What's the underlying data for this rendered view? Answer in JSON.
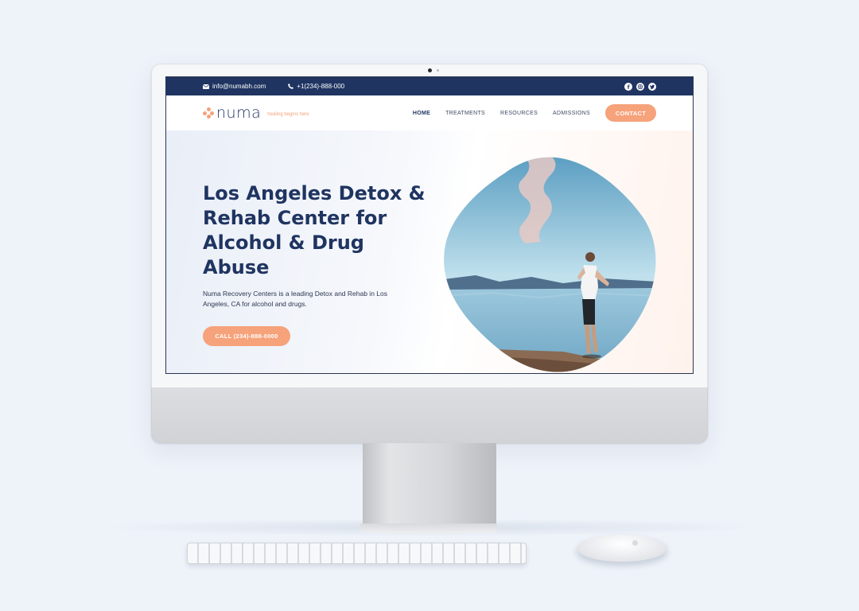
{
  "topbar": {
    "email": "info@numabh.com",
    "phone": "+1(234)-888-000",
    "socials": [
      "facebook-icon",
      "instagram-icon",
      "twitter-icon"
    ]
  },
  "brand": {
    "name": "numa",
    "tagline": "healing begins here"
  },
  "nav": {
    "items": [
      "HOME",
      "TREATMENTS",
      "RESOURCES",
      "ADMISSIONS"
    ],
    "active": "HOME",
    "contact_label": "CONTACT"
  },
  "hero": {
    "title": "Los Angeles Detox & Rehab Center for Alcohol & Drug Abuse",
    "description": "Numa Recovery Centers is a leading Detox and Rehab in Los Angeles, CA for alcohol and drugs.",
    "cta_label": "CALL (234)-888-0000"
  },
  "colors": {
    "navy": "#1f3461",
    "accent": "#f6a27a",
    "background": "#eef2f9"
  }
}
